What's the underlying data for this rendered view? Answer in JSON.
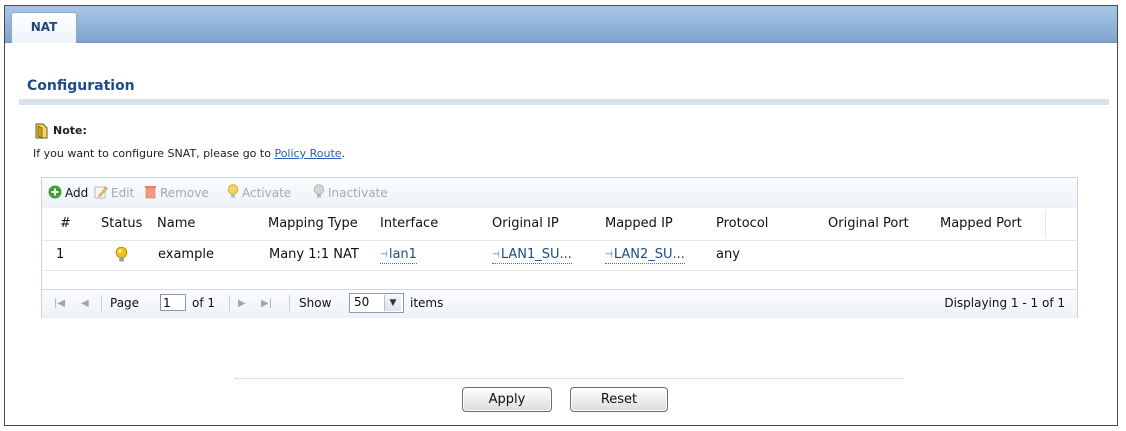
{
  "tab": {
    "label": "NAT"
  },
  "section": {
    "title": "Configuration"
  },
  "note": {
    "title": "Note:",
    "text": "If you want to configure SNAT, please go to ",
    "link_label": "Policy Route",
    "suffix": "."
  },
  "toolbar": {
    "add": "Add",
    "edit": "Edit",
    "remove": "Remove",
    "activate": "Activate",
    "inactivate": "Inactivate"
  },
  "table": {
    "columns": [
      "#",
      "Status",
      "Name",
      "Mapping Type",
      "Interface",
      "Original IP",
      "Mapped IP",
      "Protocol",
      "Original Port",
      "Mapped Port"
    ],
    "rows": [
      {
        "index": "1",
        "status": "active",
        "name": "example",
        "mapping_type": "Many 1:1 NAT",
        "interface": "lan1",
        "original_ip": "LAN1_SU...",
        "mapped_ip": "LAN2_SU...",
        "protocol": "any",
        "original_port": "",
        "mapped_port": ""
      }
    ]
  },
  "pager": {
    "page_label": "Page",
    "page_value": "1",
    "of_label": "of 1",
    "show_label": "Show",
    "show_value": "50",
    "items_label": "items",
    "displaying": "Displaying 1 - 1 of 1"
  },
  "buttons": {
    "apply": "Apply",
    "reset": "Reset"
  },
  "colors": {
    "tab_bar": "#7fa4cf",
    "title": "#1f4c85",
    "link": "#2a5fb8",
    "status_active": "#f2c21a"
  }
}
